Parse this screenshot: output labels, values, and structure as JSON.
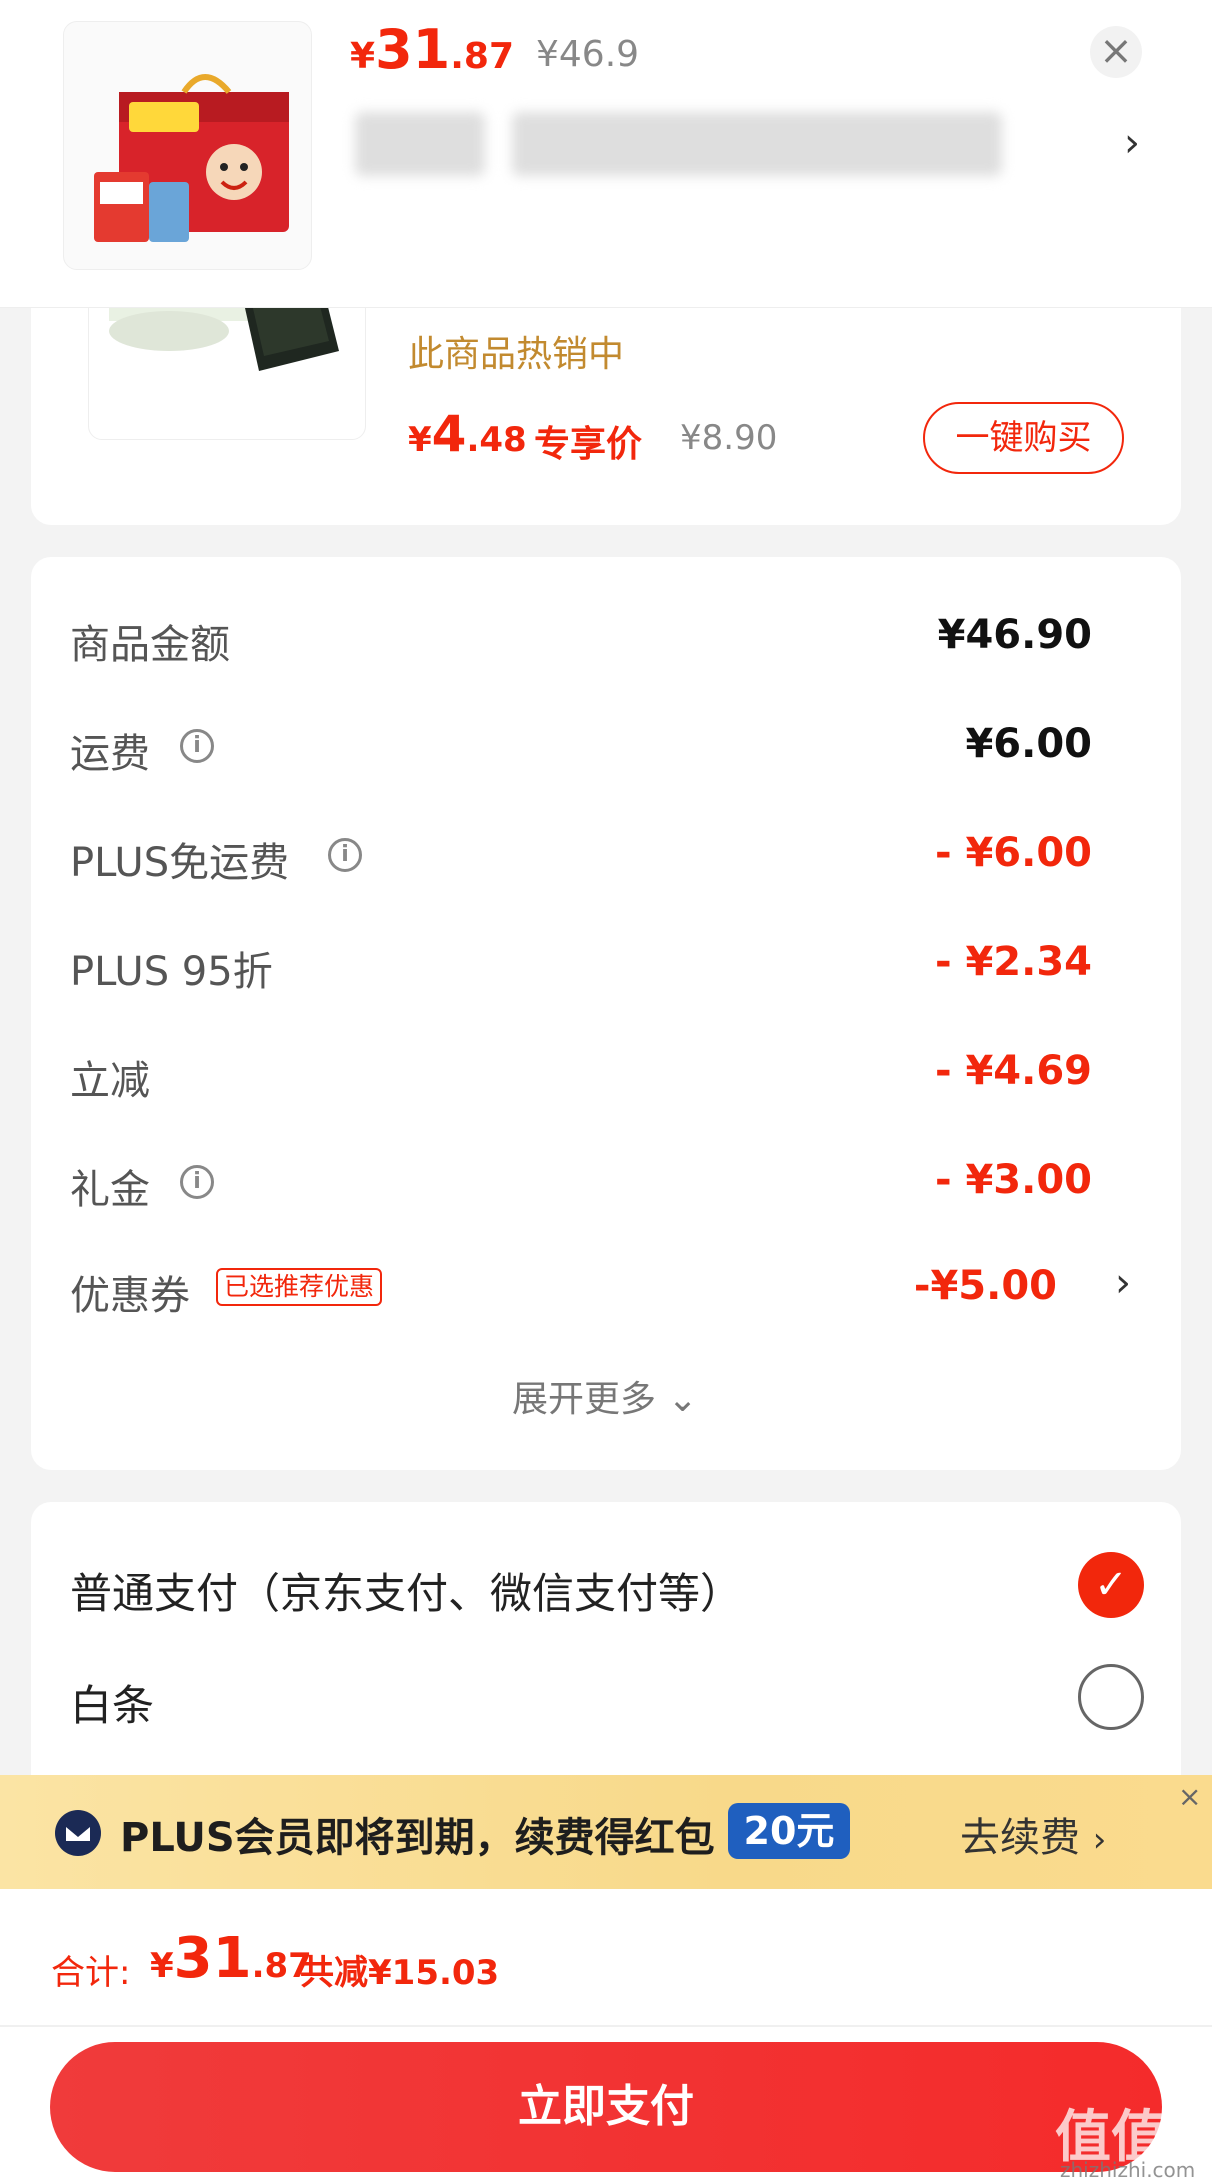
{
  "header": {
    "price": {
      "yen": "¥",
      "int": "31",
      "dec": ".87"
    },
    "original_price": "¥46.9"
  },
  "recommend": {
    "hot_text": "此商品热销中",
    "price": {
      "yen": "¥",
      "int": "4",
      "dec": ".48"
    },
    "price_tag": "专享价",
    "original_price": "¥8.90",
    "buy_button": "一键购买"
  },
  "breakdown": {
    "rows": [
      {
        "label": "商品金额",
        "value": "¥46.90"
      },
      {
        "label": "运费",
        "value": "¥6.00"
      },
      {
        "label": "PLUS免运费",
        "value": "- ¥6.00"
      },
      {
        "label": "PLUS 95折",
        "value": "- ¥2.34"
      },
      {
        "label": "立减",
        "value": "- ¥4.69"
      },
      {
        "label": "礼金",
        "value": "- ¥3.00"
      },
      {
        "label": "优惠券",
        "value": "-¥5.00"
      }
    ],
    "coupon_badge": "已选推荐优惠",
    "expand_more": "展开更多"
  },
  "payment": {
    "options": [
      {
        "label": "普通支付（京东支付、微信支付等）",
        "selected": true
      },
      {
        "label": "白条",
        "selected": false
      }
    ]
  },
  "plus_banner": {
    "text": "PLUS会员即将到期，续费得红包",
    "pill": "20元",
    "renew": "去续费"
  },
  "bottom": {
    "total_label": "合计:",
    "total": {
      "yen": "¥",
      "int": "31",
      "dec": ".87"
    },
    "saved": "共减¥15.03",
    "pay_button": "立即支付"
  },
  "watermark": {
    "main": "值值值",
    "sub": "zhizhizhi.com"
  },
  "colors": {
    "accent": "#f2270c",
    "gold": "#c28a2f",
    "plus_blue": "#1f5fbf"
  }
}
